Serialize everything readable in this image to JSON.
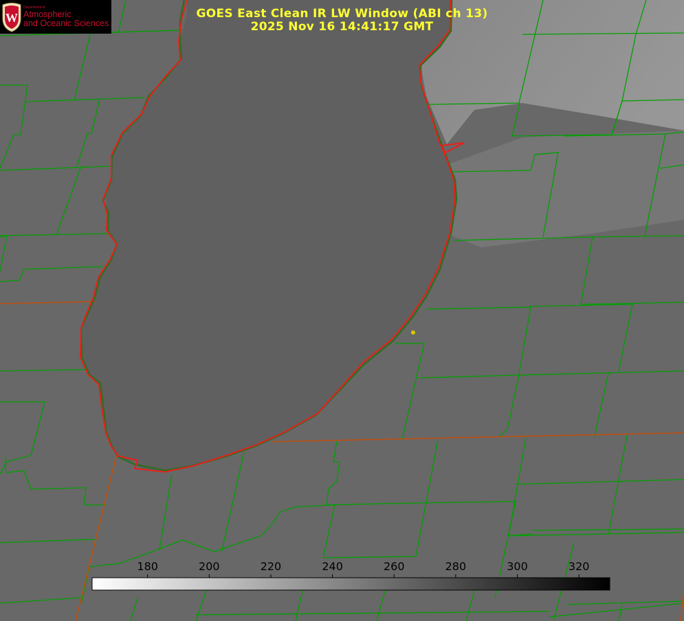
{
  "title": {
    "line1": "GOES East Clean IR LW Window (ABI ch 13)",
    "line2": "2025 Nov 16 14:41:17 GMT"
  },
  "logo": {
    "department": "Department of",
    "line1": "Atmospheric",
    "line2": "and Oceanic Sciences",
    "crest_letter": "W"
  },
  "colorbar": {
    "ticks": [
      "180",
      "200",
      "220",
      "240",
      "260",
      "280",
      "300",
      "320"
    ],
    "scale_min": 162,
    "scale_max": 330,
    "gradient_from": "#ffffff",
    "gradient_to": "#000000"
  },
  "colors": {
    "lake_outline": "#e8201a",
    "county_lines": "#00a000",
    "state_line": "#c05010",
    "marker": "#d8c800",
    "title_text": "#ffff33"
  }
}
